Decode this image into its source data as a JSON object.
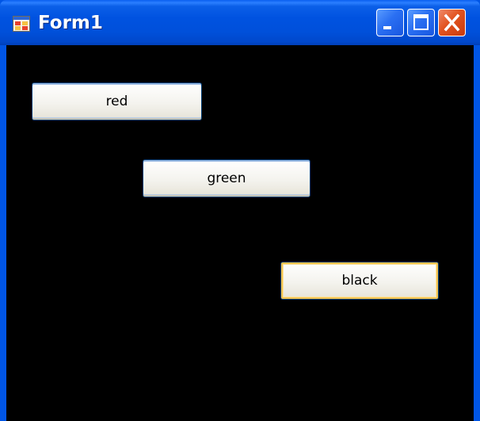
{
  "window": {
    "title": "Form1",
    "icon": "form-app-icon",
    "controls": {
      "minimize": "minimize-icon",
      "maximize": "maximize-icon",
      "close": "close-icon"
    },
    "client_background": "#000000"
  },
  "buttons": {
    "red": {
      "label": "red"
    },
    "green": {
      "label": "green"
    },
    "black": {
      "label": "black",
      "focused": true
    }
  },
  "colors": {
    "titlebar": "#0054e3",
    "close_button": "#e2531f",
    "focus_border": "#f5c34f"
  }
}
